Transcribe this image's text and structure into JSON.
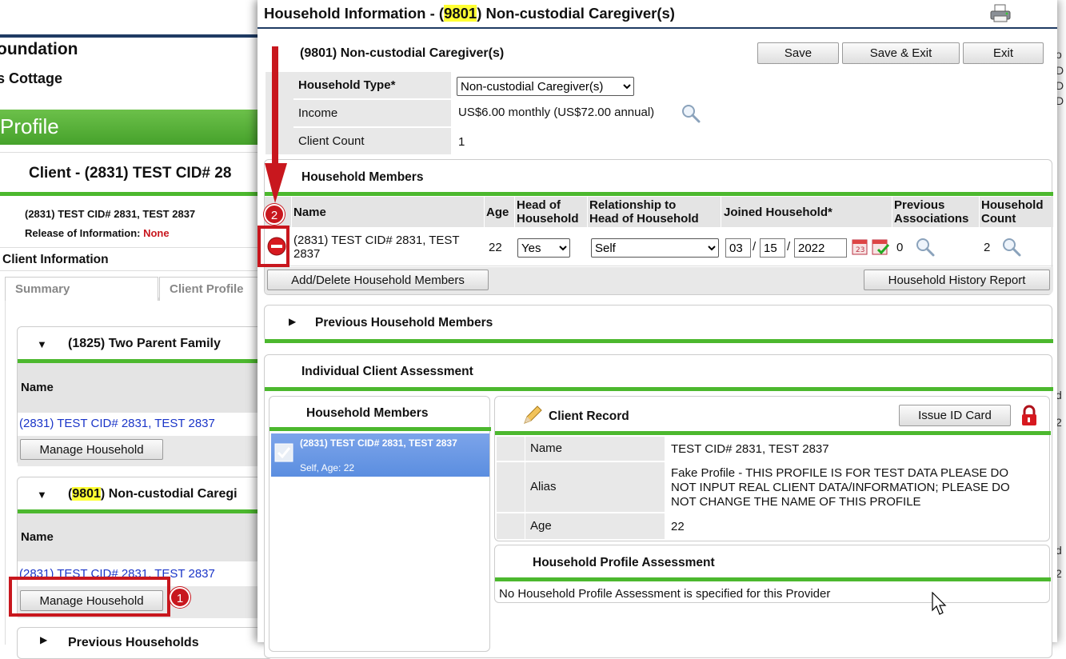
{
  "background": {
    "org_name": "oundation",
    "cottage": "s Cottage",
    "profile_title": "Profile",
    "client_title": "Client - (2831) TEST CID# 28",
    "client_line": "(2831) TEST CID# 2831, TEST 2837",
    "release_label": "Release of Information:",
    "release_value": "None",
    "client_info_heading": "Client Information",
    "tabs": [
      "Summary",
      "Client Profile"
    ],
    "households": [
      {
        "title": "(1825) Two Parent Family",
        "name_header": "Name",
        "member": "(2831) TEST CID# 2831, TEST 2837",
        "button": "Manage Household"
      },
      {
        "title_prefix": "(",
        "title_id": "9801",
        "title_suffix": ") Non-custodial Caregi",
        "name_header": "Name",
        "member": "(2831) TEST CID# 2831, TEST 2837",
        "button": "Manage Household"
      }
    ],
    "previous_households": "Previous Households",
    "right_edge_letters": [
      "o",
      "D",
      "D",
      "D",
      "d",
      "2",
      "d",
      "2"
    ]
  },
  "modal": {
    "title_prefix": "Household Information - (",
    "title_id": "9801",
    "title_suffix": ") Non-custodial Caregiver(s)",
    "print_icon": "printer-icon",
    "subheading": "(9801) Non-custodial Caregiver(s)",
    "buttons": {
      "save": "Save",
      "save_exit": "Save & Exit",
      "exit": "Exit"
    },
    "details": {
      "household_type_label": "Household Type",
      "required_mark": "*",
      "household_type_value": "Non-custodial Caregiver(s)",
      "income_label": "Income",
      "income_value": "US$6.00 monthly (US$72.00 annual)",
      "client_count_label": "Client Count",
      "client_count_value": "1"
    },
    "members_section": {
      "heading": "Household Members",
      "columns": {
        "name": "Name",
        "age": "Age",
        "head_1": "Head of",
        "head_2": "Household",
        "rel_1": "Relationship to",
        "rel_2": "Head of Household",
        "joined": "Joined Household",
        "prev_1": "Previous",
        "prev_2": "Associations",
        "count_1": "Household",
        "count_2": "Count"
      },
      "row": {
        "name": "(2831) TEST CID# 2831, TEST 2837",
        "age": "22",
        "head_value": "Yes",
        "relationship_value": "Self",
        "date_month": "03",
        "date_day": "15",
        "date_year": "2022",
        "date_sep": "/",
        "previous_associations": "0",
        "household_count": "2"
      },
      "add_delete_button": "Add/Delete Household Members",
      "history_button": "Household History Report"
    },
    "previous_members_heading": "Previous Household Members",
    "assessment": {
      "heading": "Individual Client Assessment",
      "left_heading": "Household Members",
      "selected_member_name": "(2831) TEST CID# 2831, TEST 2837",
      "selected_member_sub": "Self, Age: 22",
      "client_record_heading": "Client Record",
      "issue_id_button": "Issue ID Card",
      "fields": [
        {
          "label": "Name",
          "value": "TEST CID# 2831, TEST 2837"
        },
        {
          "label": "Alias",
          "value": "Fake Profile - THIS PROFILE IS FOR TEST DATA PLEASE DO NOT INPUT REAL CLIENT DATA/INFORMATION; PLEASE DO NOT CHANGE THE NAME OF THIS PROFILE"
        },
        {
          "label": "Age",
          "value": "22"
        }
      ],
      "profile_assessment_heading": "Household Profile Assessment",
      "profile_assessment_text": "No Household Profile Assessment is specified for this Provider"
    }
  },
  "annotations": {
    "callout_1": "1",
    "callout_2": "2"
  },
  "colors": {
    "accent_green": "#4cb82e",
    "header_navy": "#1f3b63",
    "annotation_red": "#c8171e",
    "selection_blue": "#5b8ee0"
  }
}
